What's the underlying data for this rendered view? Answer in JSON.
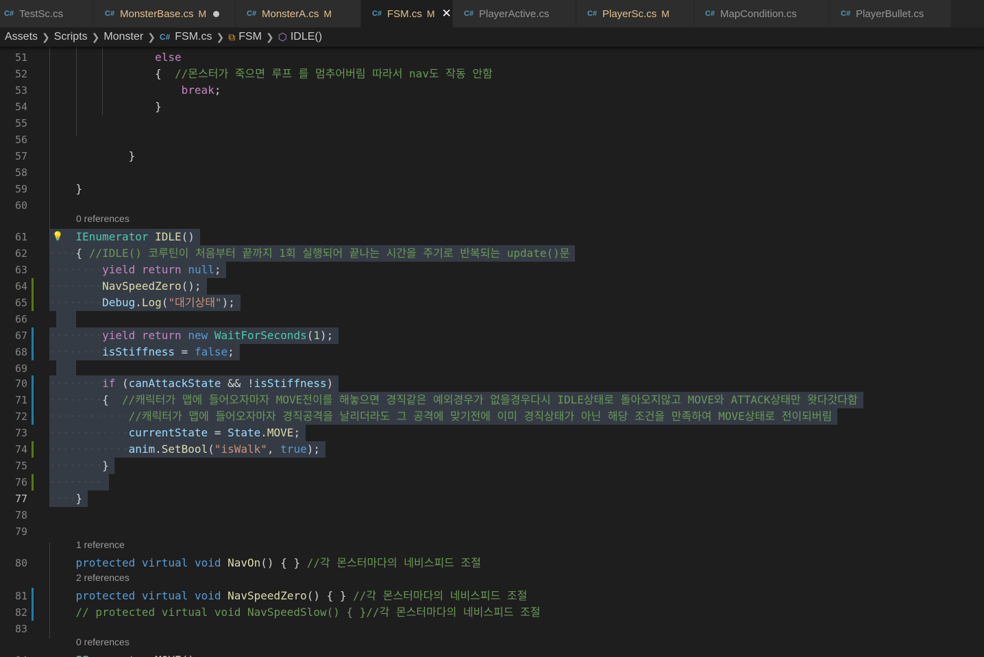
{
  "tabs": [
    {
      "name": "TestSc.cs",
      "icon": "csharp-file-icon",
      "modified": false,
      "active": false
    },
    {
      "name": "MonsterBase.cs",
      "icon": "csharp-file-icon",
      "modified": true,
      "marker": "M",
      "unsaved": true,
      "active": false
    },
    {
      "name": "MonsterA.cs",
      "icon": "csharp-file-icon",
      "modified": true,
      "marker": "M",
      "active": false
    },
    {
      "name": "FSM.cs",
      "icon": "csharp-file-icon",
      "modified": true,
      "marker": "M",
      "active": true
    },
    {
      "name": "PlayerActive.cs",
      "icon": "csharp-file-icon",
      "modified": false,
      "active": false
    },
    {
      "name": "PlayerSc.cs",
      "icon": "csharp-file-icon",
      "modified": true,
      "marker": "M",
      "active": false
    },
    {
      "name": "MapCondition.cs",
      "icon": "csharp-file-icon",
      "modified": false,
      "active": false
    },
    {
      "name": "PlayerBullet.cs",
      "icon": "csharp-file-icon",
      "modified": false,
      "active": false
    }
  ],
  "breadcrumb": [
    "Assets",
    "Scripts",
    "Monster",
    "FSM.cs",
    "FSM",
    "IDLE()"
  ],
  "codelens": {
    "l61": "0 references",
    "l80": "1 reference",
    "l81": "2 references",
    "l84": "0 references"
  },
  "lines": {
    "l51": "else",
    "l52": "{  //몬스터가 죽으면 루프 를 멈추어버림 따라서 nav도 작동 안함",
    "l53": "break;",
    "l54": "}",
    "l57": "}",
    "l59": "}",
    "l61": "IEnumerator IDLE()",
    "l62": "{ //IDLE() 코루틴이 처음부터 끝까지 1회 실행되어 끝나는 시간을 주기로 반복되는 update()문",
    "l63": "yield return null;",
    "l64": "NavSpeedZero();",
    "l65": "Debug.Log(\"대기상태\");",
    "l67": "yield return new WaitForSeconds(1);",
    "l68": "isStiffness = false;",
    "l70": "if (canAttackState && !isStiffness)",
    "l71": "{  //캐릭터가 맵에 들어오자마자 MOVE전이를 해놓으면 경직같은 예외경우가 없을경우다시 IDLE상태로 돌아오지않고 MOVE와 ATTACK상태만 왓다갓다함",
    "l72": "//캐릭터가 맵에 들어오자마자 경직공격을 날리더라도 그 공격에 맞기전에 이미 경직상태가 아닌 해당 조건을 만족하여 MOVE상태로 전이되버림",
    "l73": "currentState = State.MOVE;",
    "l74": "anim.SetBool(\"isWalk\", true);",
    "l75": "}",
    "l77": "}",
    "l80": "protected virtual void NavOn() { } //각 몬스터마다의 네비스피드 조절",
    "l81": "protected virtual void NavSpeedZero() { } //각 몬스터마다의 네비스피드 조절",
    "l82": "// protected virtual void NavSpeedSlow() { }//각 몬스터마다의 네비스피드 조절",
    "l84": "IEnumerator MOVE()"
  },
  "colors": {
    "keyword": "#569cd6",
    "control": "#c586c0",
    "type": "#4ec9b0",
    "function": "#dcdcaa",
    "comment": "#6a9955",
    "string": "#ce9178",
    "number": "#b5cea8",
    "variable": "#9cdcfe",
    "selection": "#353b45",
    "gutter_added": "#587c0c",
    "gutter_modified": "#1b81a8"
  }
}
